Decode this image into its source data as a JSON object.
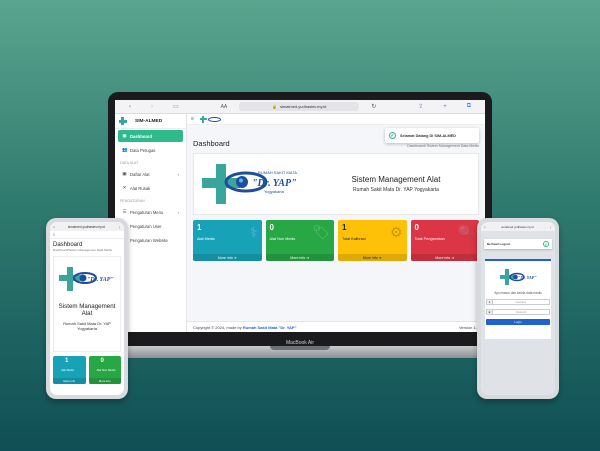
{
  "browser": {
    "aa": "AA",
    "url": "simalmed.yudhasiev.my.id",
    "lock_icon": "lock-icon"
  },
  "brand": {
    "sidebar_title": "SIM-ALMED",
    "hospital_top": "RUMAH SAKIT MATA",
    "hospital_name": "\"Dr. YAP\"",
    "hospital_city": "Yogyakarta"
  },
  "sidebar": {
    "items": [
      {
        "label": "Dashboard",
        "icon": "dashboard-icon",
        "active": true
      },
      {
        "label": "Data Petugas",
        "icon": "users-icon"
      }
    ],
    "section1": "DATA ALAT",
    "items2": [
      {
        "label": "Daftar Alat",
        "icon": "box-icon",
        "chevron": true
      },
      {
        "label": "Alat Rusak",
        "icon": "tools-icon"
      }
    ],
    "section2": "PENGATURAN",
    "items3": [
      {
        "label": "Pengaturan Menu",
        "icon": "menu-icon",
        "chevron": true
      },
      {
        "label": "Pengaturan User",
        "icon": "user-cog-icon"
      },
      {
        "label": "Pengaturan Website",
        "icon": "globe-icon"
      }
    ]
  },
  "topnav": {
    "hamburger": "≡"
  },
  "toast": {
    "message": "Selamat Datang Di SIM-ALMED"
  },
  "page": {
    "title": "Dashboard",
    "breadcrumb": "Dashboard/ Sistem Management Data Medis"
  },
  "hero": {
    "title": "Sistem Management Alat",
    "subtitle": "Rumah Sakit Mata Dr. YAP Yogyakarta"
  },
  "boxes": [
    {
      "value": "1",
      "label": "Alat Medis",
      "more": "More info",
      "color": "#17a2b8",
      "icon": "stethoscope-icon"
    },
    {
      "value": "0",
      "label": "Alat Non Medis",
      "more": "More info",
      "color": "#28a745",
      "icon": "tag-icon"
    },
    {
      "value": "1",
      "label": "Total Kalibrasi",
      "more": "More info",
      "color": "#ffc107",
      "icon": "cogs-icon"
    },
    {
      "value": "0",
      "label": "Total Pengecekan",
      "more": "More info",
      "color": "#dc3545",
      "icon": "search-icon"
    }
  ],
  "footer": {
    "copyright": "Copyright © 2024, made by",
    "link": "Rumah Sakit Mata \"Dr. YAP\"",
    "version": "Version 1.0"
  },
  "laptop": {
    "model": "MacBook Air"
  },
  "phone_left": {
    "url": "simalmed.yudhasiev.my.id",
    "title": "Dashboard",
    "breadcrumb": "Dashboard/Sistem Management Data Medis",
    "hero_title": "Sistem Management Alat",
    "hero_sub": "Rumah Sakit Mata Dr. YAP Yogyakarta",
    "boxes": [
      {
        "value": "1",
        "label": "Alat Medis",
        "more": "More info"
      },
      {
        "value": "0",
        "label": "Alat Non Medis",
        "more": "More info"
      }
    ]
  },
  "phone_right": {
    "url": "simalmed.yudhasiev.my.id",
    "toast": "Berhasil Logout",
    "login_msg": "Ayo masuk dan kelola data medis",
    "username_placeholder": "Username",
    "password_placeholder": "Password",
    "button": "Login"
  },
  "colors": {
    "accent": "#2dbb8b",
    "primary": "#1e62d0",
    "logo_green": "#3aa59a",
    "logo_blue": "#1d4e9e"
  }
}
